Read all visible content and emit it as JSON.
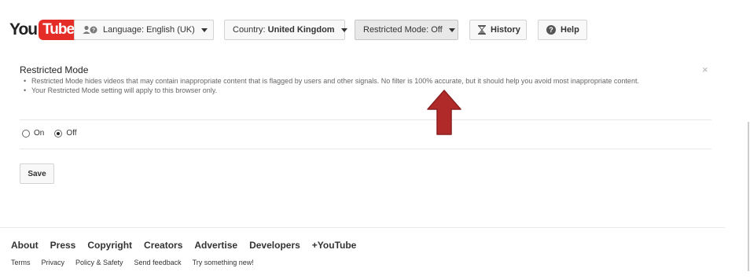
{
  "header": {
    "logo_you": "You",
    "logo_tube": "Tube",
    "language_label": "Language:",
    "language_value": "English (UK)",
    "country_label": "Country:",
    "country_value": "United Kingdom",
    "restricted_label": "Restricted Mode: Off",
    "history_label": "History",
    "help_label": "Help"
  },
  "restricted_panel": {
    "title": "Restricted Mode",
    "close_glyph": "×",
    "bullets": [
      "Restricted Mode hides videos that may contain inappropriate content that is flagged by users and other signals. No filter is 100% accurate, but it should help you avoid most inappropriate content.",
      "Your Restricted Mode setting will apply to this browser only."
    ],
    "options": [
      {
        "label": "On",
        "checked": false
      },
      {
        "label": "Off",
        "checked": true
      }
    ],
    "save_label": "Save"
  },
  "annotation": {
    "arrow_color": "#b02a2a",
    "arrow_direction": "up"
  },
  "footer": {
    "primary_links": [
      "About",
      "Press",
      "Copyright",
      "Creators",
      "Advertise",
      "Developers",
      "+YouTube"
    ],
    "secondary_links": [
      "Terms",
      "Privacy",
      "Policy & Safety",
      "Send feedback",
      "Try something new!"
    ]
  },
  "colors": {
    "brand_red": "#e52d27",
    "text_dark": "#222222",
    "text_muted": "#666666"
  }
}
